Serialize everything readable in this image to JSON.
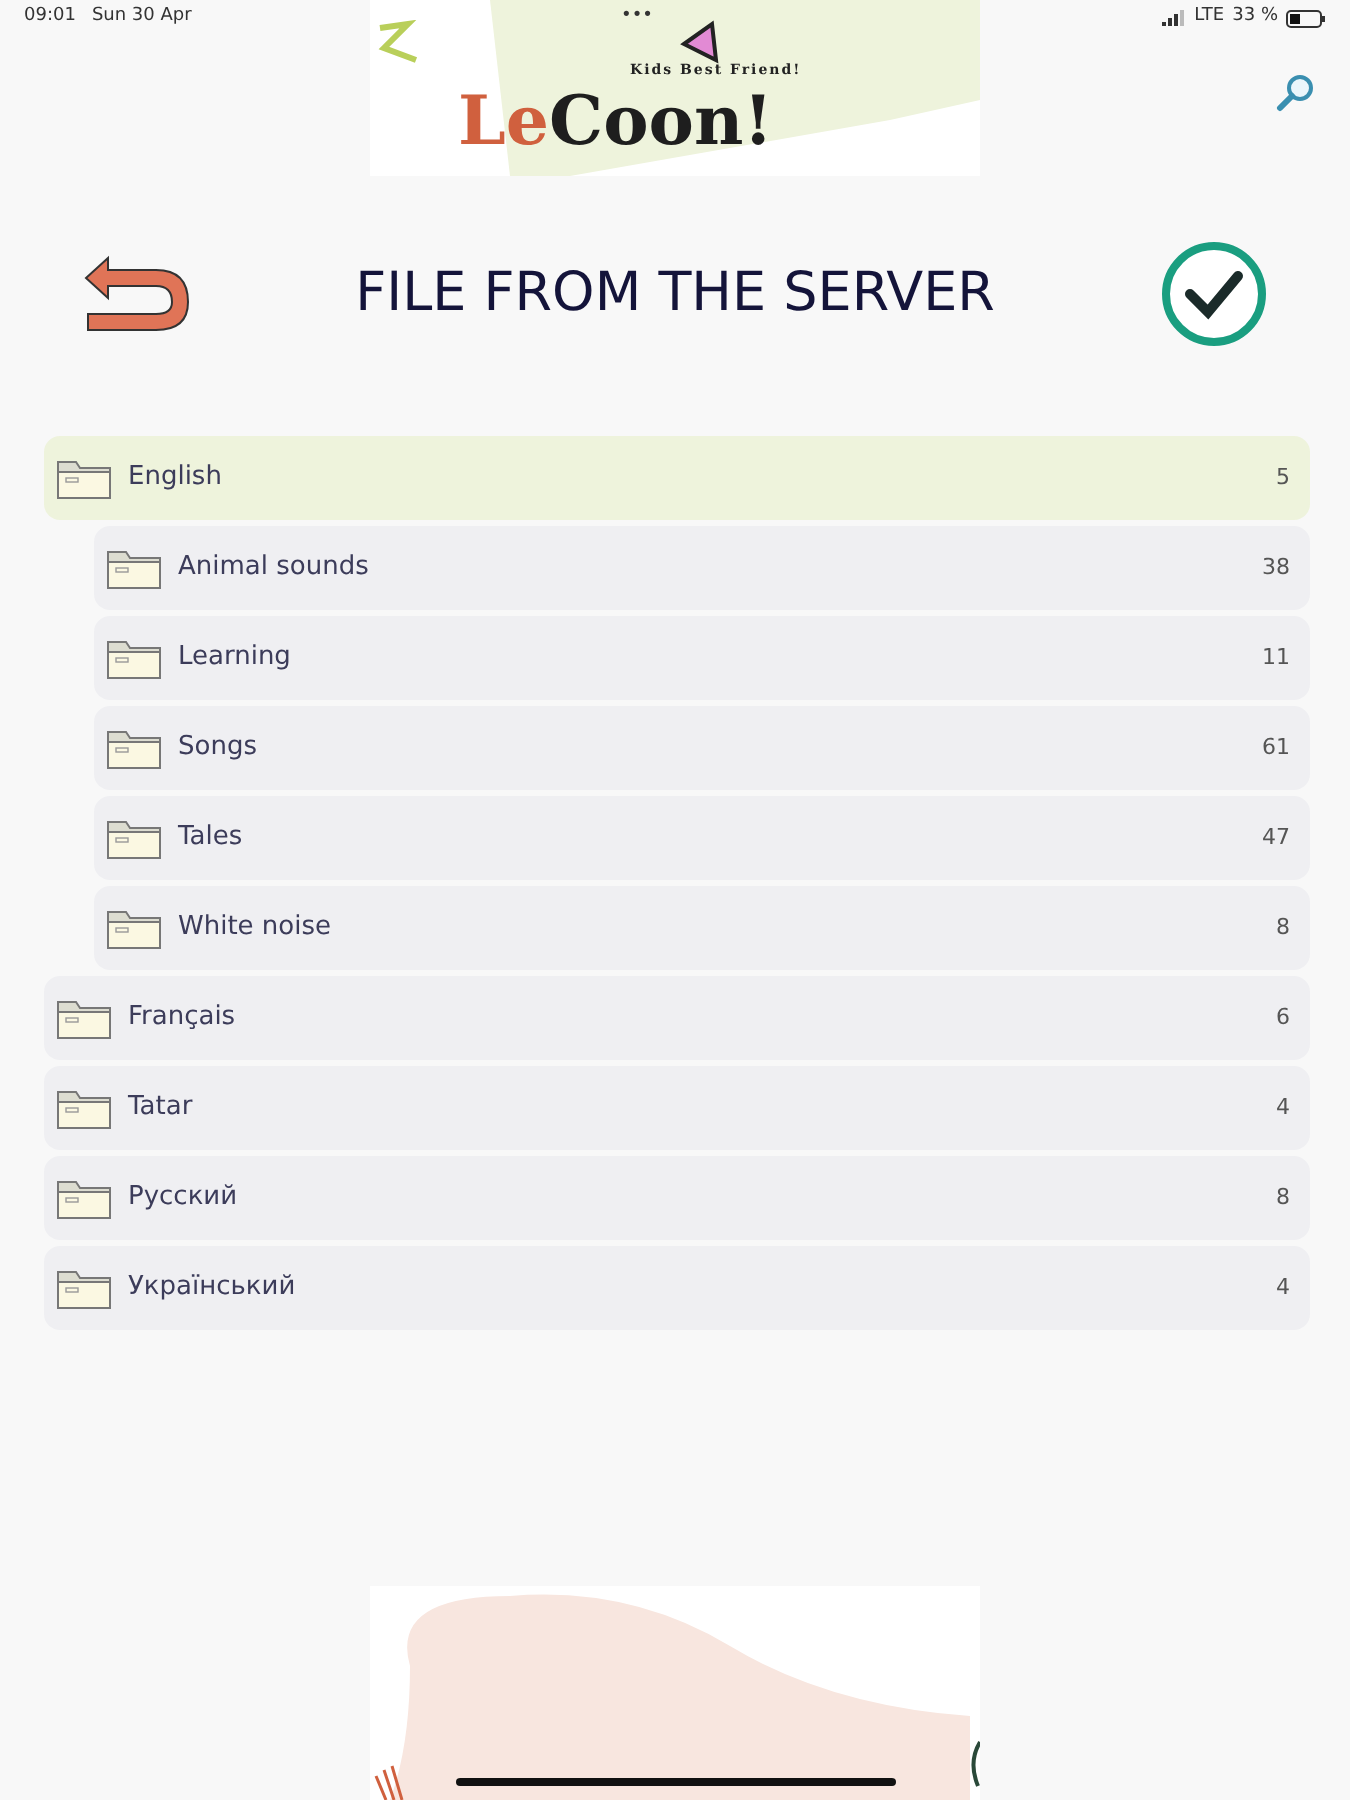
{
  "status_bar": {
    "time": "09:01",
    "date": "Sun 30 Apr",
    "dots": "•••",
    "network": "LTE",
    "battery_text": "33 %"
  },
  "banner": {
    "tagline": "Kids Best Friend!",
    "logo_first": "Le",
    "logo_second": "Coon!"
  },
  "header": {
    "title": "FILE FROM THE SERVER"
  },
  "folders": [
    {
      "name": "English",
      "count": "5",
      "selected": true,
      "children": [
        {
          "name": "Animal sounds",
          "count": "38",
          "selected": false
        },
        {
          "name": "Learning",
          "count": "11",
          "selected": false
        },
        {
          "name": "Songs",
          "count": "61",
          "selected": false
        },
        {
          "name": "Tales",
          "count": "47",
          "selected": false
        },
        {
          "name": "White noise",
          "count": "8",
          "selected": false
        }
      ]
    },
    {
      "name": "Français",
      "count": "6",
      "selected": false
    },
    {
      "name": "Tatar",
      "count": "4",
      "selected": false
    },
    {
      "name": "Русский",
      "count": "8",
      "selected": false
    },
    {
      "name": "Український",
      "count": "4",
      "selected": false
    }
  ]
}
